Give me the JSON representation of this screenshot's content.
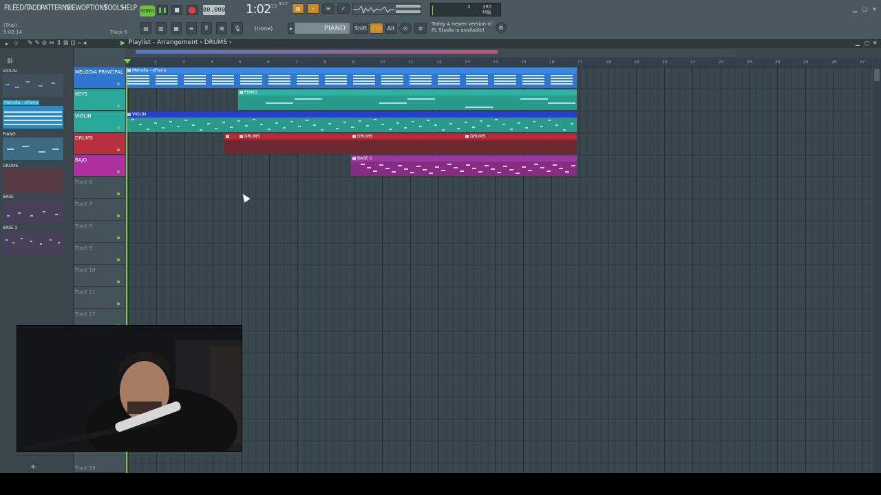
{
  "menu": [
    "FILE",
    "EDIT",
    "ADD",
    "PATTERNS",
    "VIEW",
    "OPTIONS",
    "TOOLS",
    "HELP"
  ],
  "trial": "(Trial)",
  "trial_time": "5:02:14",
  "hint_track": "Track 6",
  "transport": {
    "mode_label": "SONG",
    "tempo": "80.000",
    "time": "1:02",
    "time_small": "12",
    "time_unit": "B:S:T"
  },
  "monitor": {
    "cpu": "3",
    "mem": "385 MB",
    "poly": "0"
  },
  "toolbar2": {
    "preset": "(none)",
    "instrument": "PIANO",
    "shift": "Shift",
    "ctrl": "Ctrl",
    "alt": "Alt"
  },
  "news": {
    "line1": "Today  A newer version of",
    "line2": "FL Studio is available!"
  },
  "playlist": {
    "title": "Playlist - Arrangement",
    "crumb": "DRUMS"
  },
  "ruler": [
    "2",
    "3",
    "4",
    "5",
    "6",
    "7",
    "8",
    "9",
    "10",
    "11",
    "12",
    "13",
    "14",
    "15",
    "16",
    "17",
    "18",
    "19",
    "20",
    "21",
    "22",
    "23",
    "24",
    "25",
    "26",
    "27"
  ],
  "patterns": [
    {
      "name": "VIOLIN",
      "color": "#2f6fc7"
    },
    {
      "name": "Melodia - ePiano",
      "color": "#2aa3cf"
    },
    {
      "name": "PIANO",
      "color": "#2da6b3"
    },
    {
      "name": "DRUMS",
      "color": "#b8303a"
    },
    {
      "name": "BASE",
      "color": "#7a3fb0"
    },
    {
      "name": "BASE 2",
      "color": "#7a3fb0"
    }
  ],
  "tracks": [
    {
      "name": "MELODIA PRINCIPAL",
      "color": "#2f76d1"
    },
    {
      "name": "KEYS",
      "color": "#2aa89a"
    },
    {
      "name": "VIOLIN",
      "color": "#2aa89a"
    },
    {
      "name": "DRUMS",
      "color": "#b83040"
    },
    {
      "name": "BAJO",
      "color": "#b02fa0"
    },
    {
      "name": "Track 6",
      "color": ""
    },
    {
      "name": "Track 7",
      "color": ""
    },
    {
      "name": "Track 8",
      "color": ""
    },
    {
      "name": "Track 9",
      "color": ""
    },
    {
      "name": "Track 10",
      "color": ""
    },
    {
      "name": "Track 11",
      "color": ""
    },
    {
      "name": "Track 12",
      "color": ""
    },
    {
      "name": "Track 19",
      "color": ""
    }
  ],
  "clips": {
    "c1": "Melodia - ePiano",
    "c2": "PIANO",
    "c3": "VIOLIN",
    "c4": "DRUMS",
    "c5": "DRUMS",
    "c6": "DRUMS",
    "c7": "BASE 2"
  },
  "colors": {
    "accent": "#6fbf3a",
    "record": "#e04040"
  }
}
